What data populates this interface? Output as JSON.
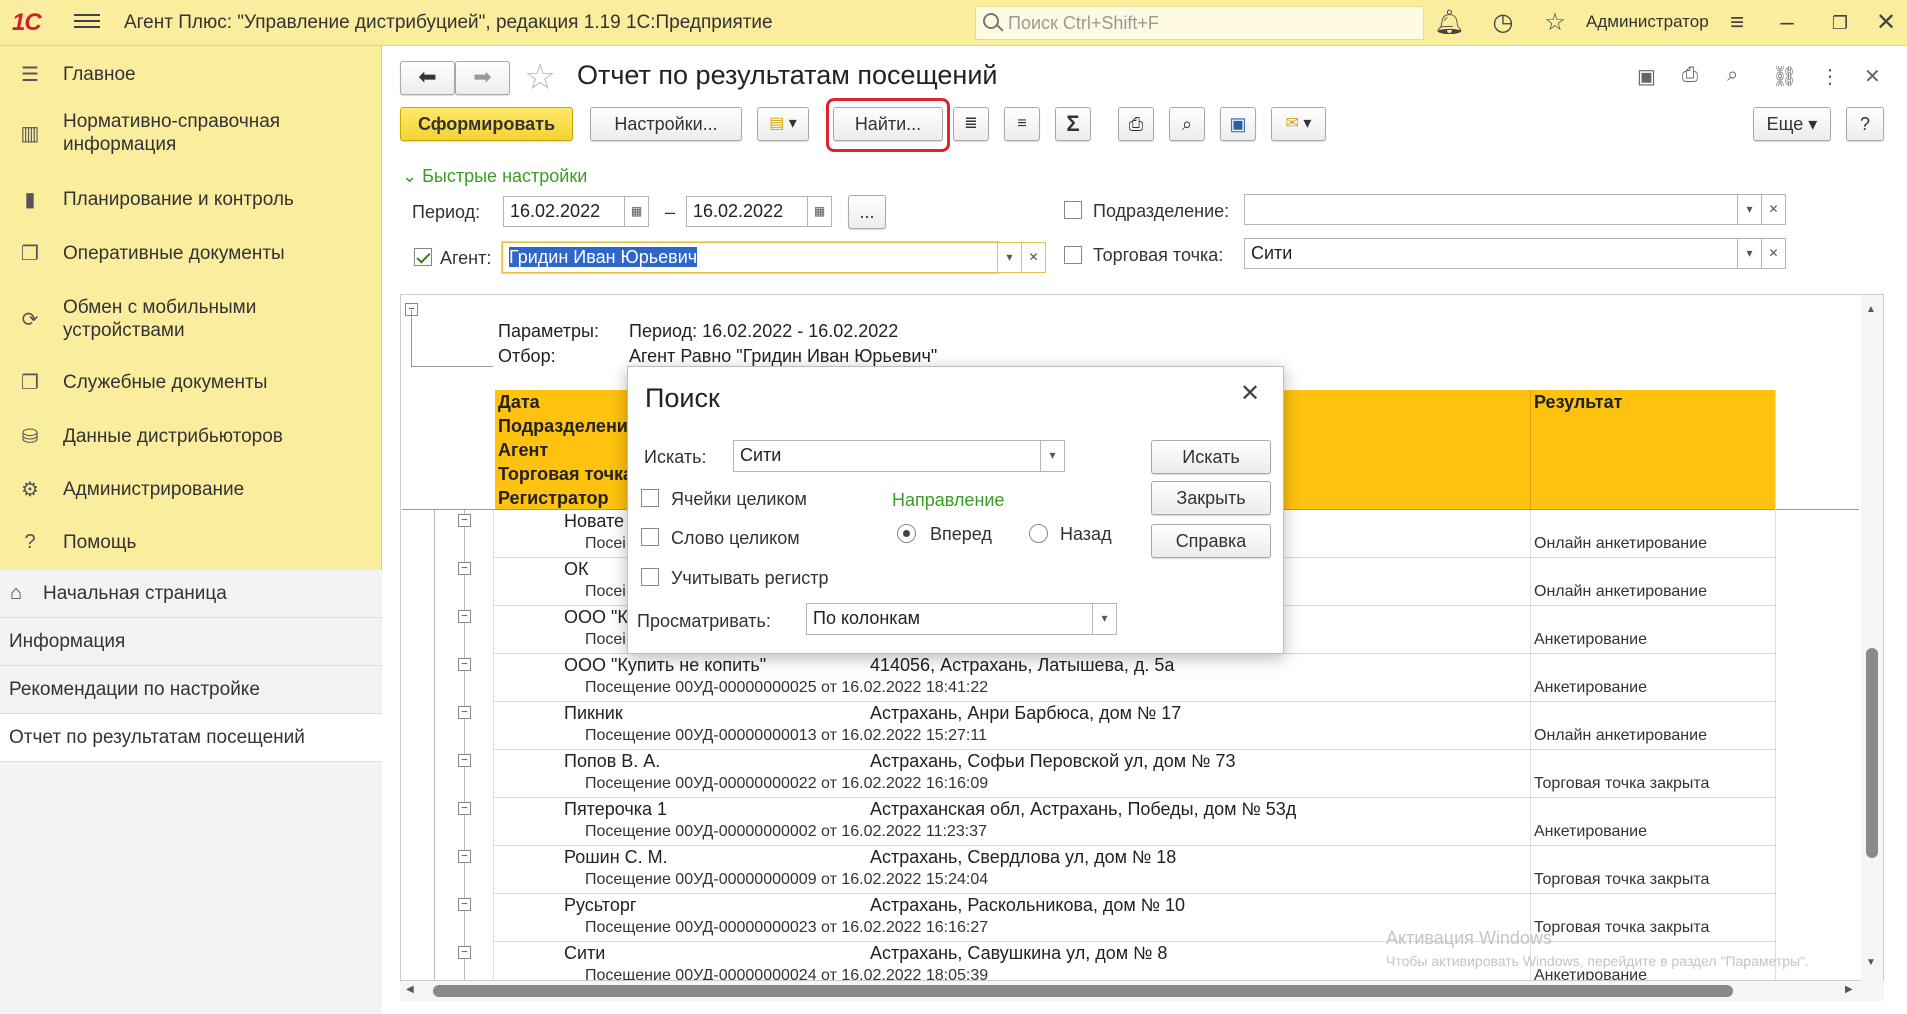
{
  "topbar": {
    "logo": "1С",
    "title": "Агент Плюс: \"Управление дистрибуцией\", редакция 1.19 1С:Предприятие",
    "search_placeholder": "Поиск Ctrl+Shift+F",
    "user": "Администратор"
  },
  "sidebar": {
    "items": [
      {
        "label": "Главное",
        "icon": "menu-icon"
      },
      {
        "label": "Нормативно-справочная информация",
        "icon": "reference-icon"
      },
      {
        "label": "Планирование и контроль",
        "icon": "chart-icon"
      },
      {
        "label": "Оперативные документы",
        "icon": "documents-icon"
      },
      {
        "label": "Обмен с мобильными устройствами",
        "icon": "sync-icon"
      },
      {
        "label": "Служебные документы",
        "icon": "service-docs-icon"
      },
      {
        "label": "Данные дистрибьюторов",
        "icon": "distributors-icon"
      },
      {
        "label": "Администрирование",
        "icon": "gear-icon"
      },
      {
        "label": "Помощь",
        "icon": "help-icon"
      }
    ],
    "open_windows": [
      {
        "label": "Начальная страница"
      },
      {
        "label": "Информация"
      },
      {
        "label": "Рекомендации по настройке"
      },
      {
        "label": "Отчет по результатам посещений"
      }
    ]
  },
  "page": {
    "title": "Отчет по результатам посещений",
    "toolbar": {
      "generate": "Сформировать",
      "settings": "Настройки...",
      "find": "Найти...",
      "more": "Еще",
      "help": "?"
    },
    "quick_settings": "Быстрые настройки",
    "period_label": "Период:",
    "period_from": "16.02.2022",
    "period_dash": "–",
    "period_to": "16.02.2022",
    "period_more": "...",
    "agent_label": "Агент:",
    "agent_value": "Гридин Иван Юрьевич",
    "division_label": "Подразделение:",
    "division_value": "",
    "outlet_label": "Торговая точка:",
    "outlet_value": "Сити"
  },
  "report": {
    "params_label": "Параметры:",
    "params_value": "Период: 16.02.2022 - 16.02.2022",
    "filter_label": "Отбор:",
    "filter_value": "Агент Равно \"Гридин Иван Юрьевич\"",
    "headers": {
      "date": "Дата",
      "division": "Подразделение",
      "agent": "Агент",
      "outlet": "Торговая точка",
      "registrar": "Регистратор",
      "result": "Результат"
    },
    "rows": [
      {
        "name": "Новате",
        "visit": "Посеі",
        "address": "",
        "result": "Онлайн анкетирование"
      },
      {
        "name": "ОК",
        "visit": "Посеі",
        "address": "",
        "result": "Онлайн анкетирование"
      },
      {
        "name": "ООО \"К",
        "visit": "Посеі",
        "address": "",
        "result": "Анкетирование"
      },
      {
        "name": "ООО \"Купить не копить\"",
        "visit": "Посещение 00УД-00000000025 от 16.02.2022 18:41:22",
        "address": "414056, Астрахань, Латышева, д. 5а",
        "result": "Анкетирование"
      },
      {
        "name": "Пикник",
        "visit": "Посещение 00УД-00000000013 от 16.02.2022 15:27:11",
        "address": "Астрахань, Анри Барбюса, дом № 17",
        "result": "Онлайн анкетирование"
      },
      {
        "name": "Попов В. А.",
        "visit": "Посещение 00УД-00000000022 от 16.02.2022 16:16:09",
        "address": "Астрахань, Софьи Перовской ул, дом № 73",
        "result": "Торговая точка закрыта"
      },
      {
        "name": "Пятерочка 1",
        "visit": "Посещение 00УД-00000000002 от 16.02.2022 11:23:37",
        "address": "Астраханская обл, Астрахань, Победы, дом № 53д",
        "result": "Анкетирование"
      },
      {
        "name": "Рошин С. М.",
        "visit": "Посещение 00УД-00000000009 от 16.02.2022 15:24:04",
        "address": "Астрахань, Свердлова ул, дом № 18",
        "result": "Торговая точка закрыта"
      },
      {
        "name": "Русьторг",
        "visit": "Посещение 00УД-00000000023 от 16.02.2022 16:16:27",
        "address": "Астрахань, Раскольникова, дом № 10",
        "result": "Торговая точка закрыта"
      },
      {
        "name": "Сити",
        "visit": "Посещение 00УД-00000000024 от 16.02.2022 18:05:39",
        "address": "Астрахань, Савушкина ул, дом № 8",
        "result": "Анкетирование"
      }
    ]
  },
  "dialog": {
    "title": "Поиск",
    "search_label": "Искать:",
    "search_value": "Сити",
    "find_button": "Искать",
    "close_button": "Закрыть",
    "help_button": "Справка",
    "whole_cells": "Ячейки целиком",
    "whole_word": "Слово целиком",
    "match_case": "Учитывать регистр",
    "direction_label": "Направление",
    "forward": "Вперед",
    "backward": "Назад",
    "browse_label": "Просматривать:",
    "browse_value": "По колонкам"
  },
  "watermark": {
    "line1": "Активация Windows",
    "line2": "Чтобы активировать Windows, перейдите в раздел \"Параметры\"."
  },
  "colors": {
    "topbar": "#fbed9e",
    "report_header": "#ffc20e",
    "accent_green": "#3a9d23",
    "highlight_red": "#e0232e"
  }
}
